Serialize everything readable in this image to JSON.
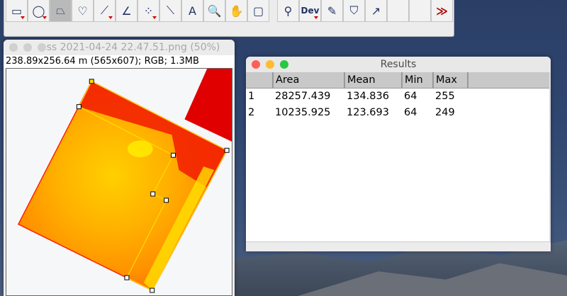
{
  "toolbar": {
    "tools": [
      {
        "name": "rectangle-tool",
        "glyph": "▭",
        "menu": true
      },
      {
        "name": "oval-tool",
        "glyph": "◯",
        "menu": true
      },
      {
        "name": "polygon-tool",
        "glyph": "⏢",
        "selected": true
      },
      {
        "name": "freehand-tool",
        "glyph": "♡"
      },
      {
        "name": "line-tool",
        "glyph": "⟋",
        "menu": true
      },
      {
        "name": "angle-tool",
        "glyph": "∠"
      },
      {
        "name": "multipoint-tool",
        "glyph": "⁘",
        "menu": true
      },
      {
        "name": "wand-tool",
        "glyph": "⟍"
      },
      {
        "name": "text-tool",
        "glyph": "A"
      },
      {
        "name": "magnifier-tool",
        "glyph": "🔍"
      },
      {
        "name": "hand-tool",
        "glyph": "✋"
      },
      {
        "name": "dropper-tool",
        "glyph": "▢"
      },
      {
        "name": "search-tool",
        "glyph": "⚲"
      },
      {
        "name": "dev-tool",
        "glyph": "Dev",
        "menu": true
      },
      {
        "name": "brush-tool",
        "glyph": "✎"
      },
      {
        "name": "fill-tool",
        "glyph": "⛉"
      },
      {
        "name": "arrow-tool",
        "glyph": "↗"
      },
      {
        "name": "blank-tool-1",
        "glyph": ""
      },
      {
        "name": "blank-tool-2",
        "glyph": ""
      },
      {
        "name": "more-tools",
        "glyph": "≫"
      }
    ]
  },
  "image_window": {
    "title": "ss 2021-04-24 22.47.51.png (50%)",
    "info": "238.89x256.64 m (565x607); RGB; 1.3MB"
  },
  "results": {
    "title": "Results",
    "columns": [
      "",
      "Area",
      "Mean",
      "Min",
      "Max"
    ],
    "rows": [
      [
        "1",
        "28257.439",
        "134.836",
        "64",
        "255"
      ],
      [
        "2",
        "10235.925",
        "123.693",
        "64",
        "249"
      ]
    ]
  },
  "colors": {
    "close": "#fe5f57",
    "minimize": "#febc2e",
    "zoom": "#28c840",
    "roi": "#ffdd00"
  }
}
